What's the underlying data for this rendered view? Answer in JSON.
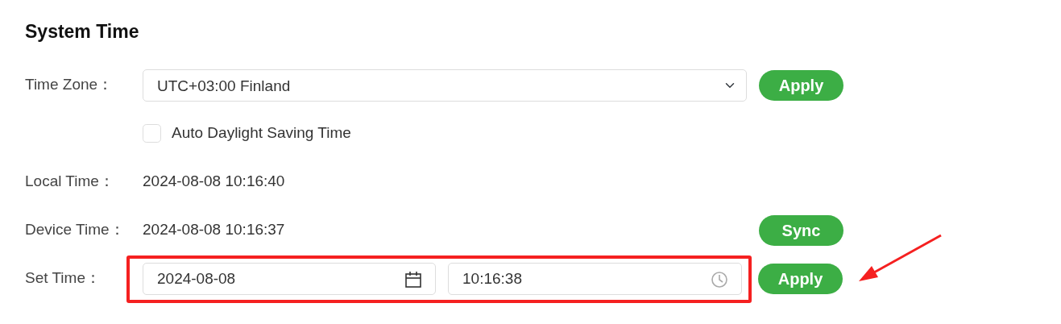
{
  "title": "System Time",
  "time_zone": {
    "label": "Time Zone：",
    "value": "UTC+03:00 Finland",
    "button": "Apply"
  },
  "auto_dst": {
    "label": "Auto Daylight Saving Time",
    "checked": false
  },
  "local_time": {
    "label": "Local Time：",
    "value": "2024-08-08 10:16:40"
  },
  "device_time": {
    "label": "Device Time：",
    "value": "2024-08-08 10:16:37",
    "button": "Sync"
  },
  "set_time": {
    "label": "Set Time：",
    "date": "2024-08-08",
    "time": "10:16:38",
    "button": "Apply"
  }
}
